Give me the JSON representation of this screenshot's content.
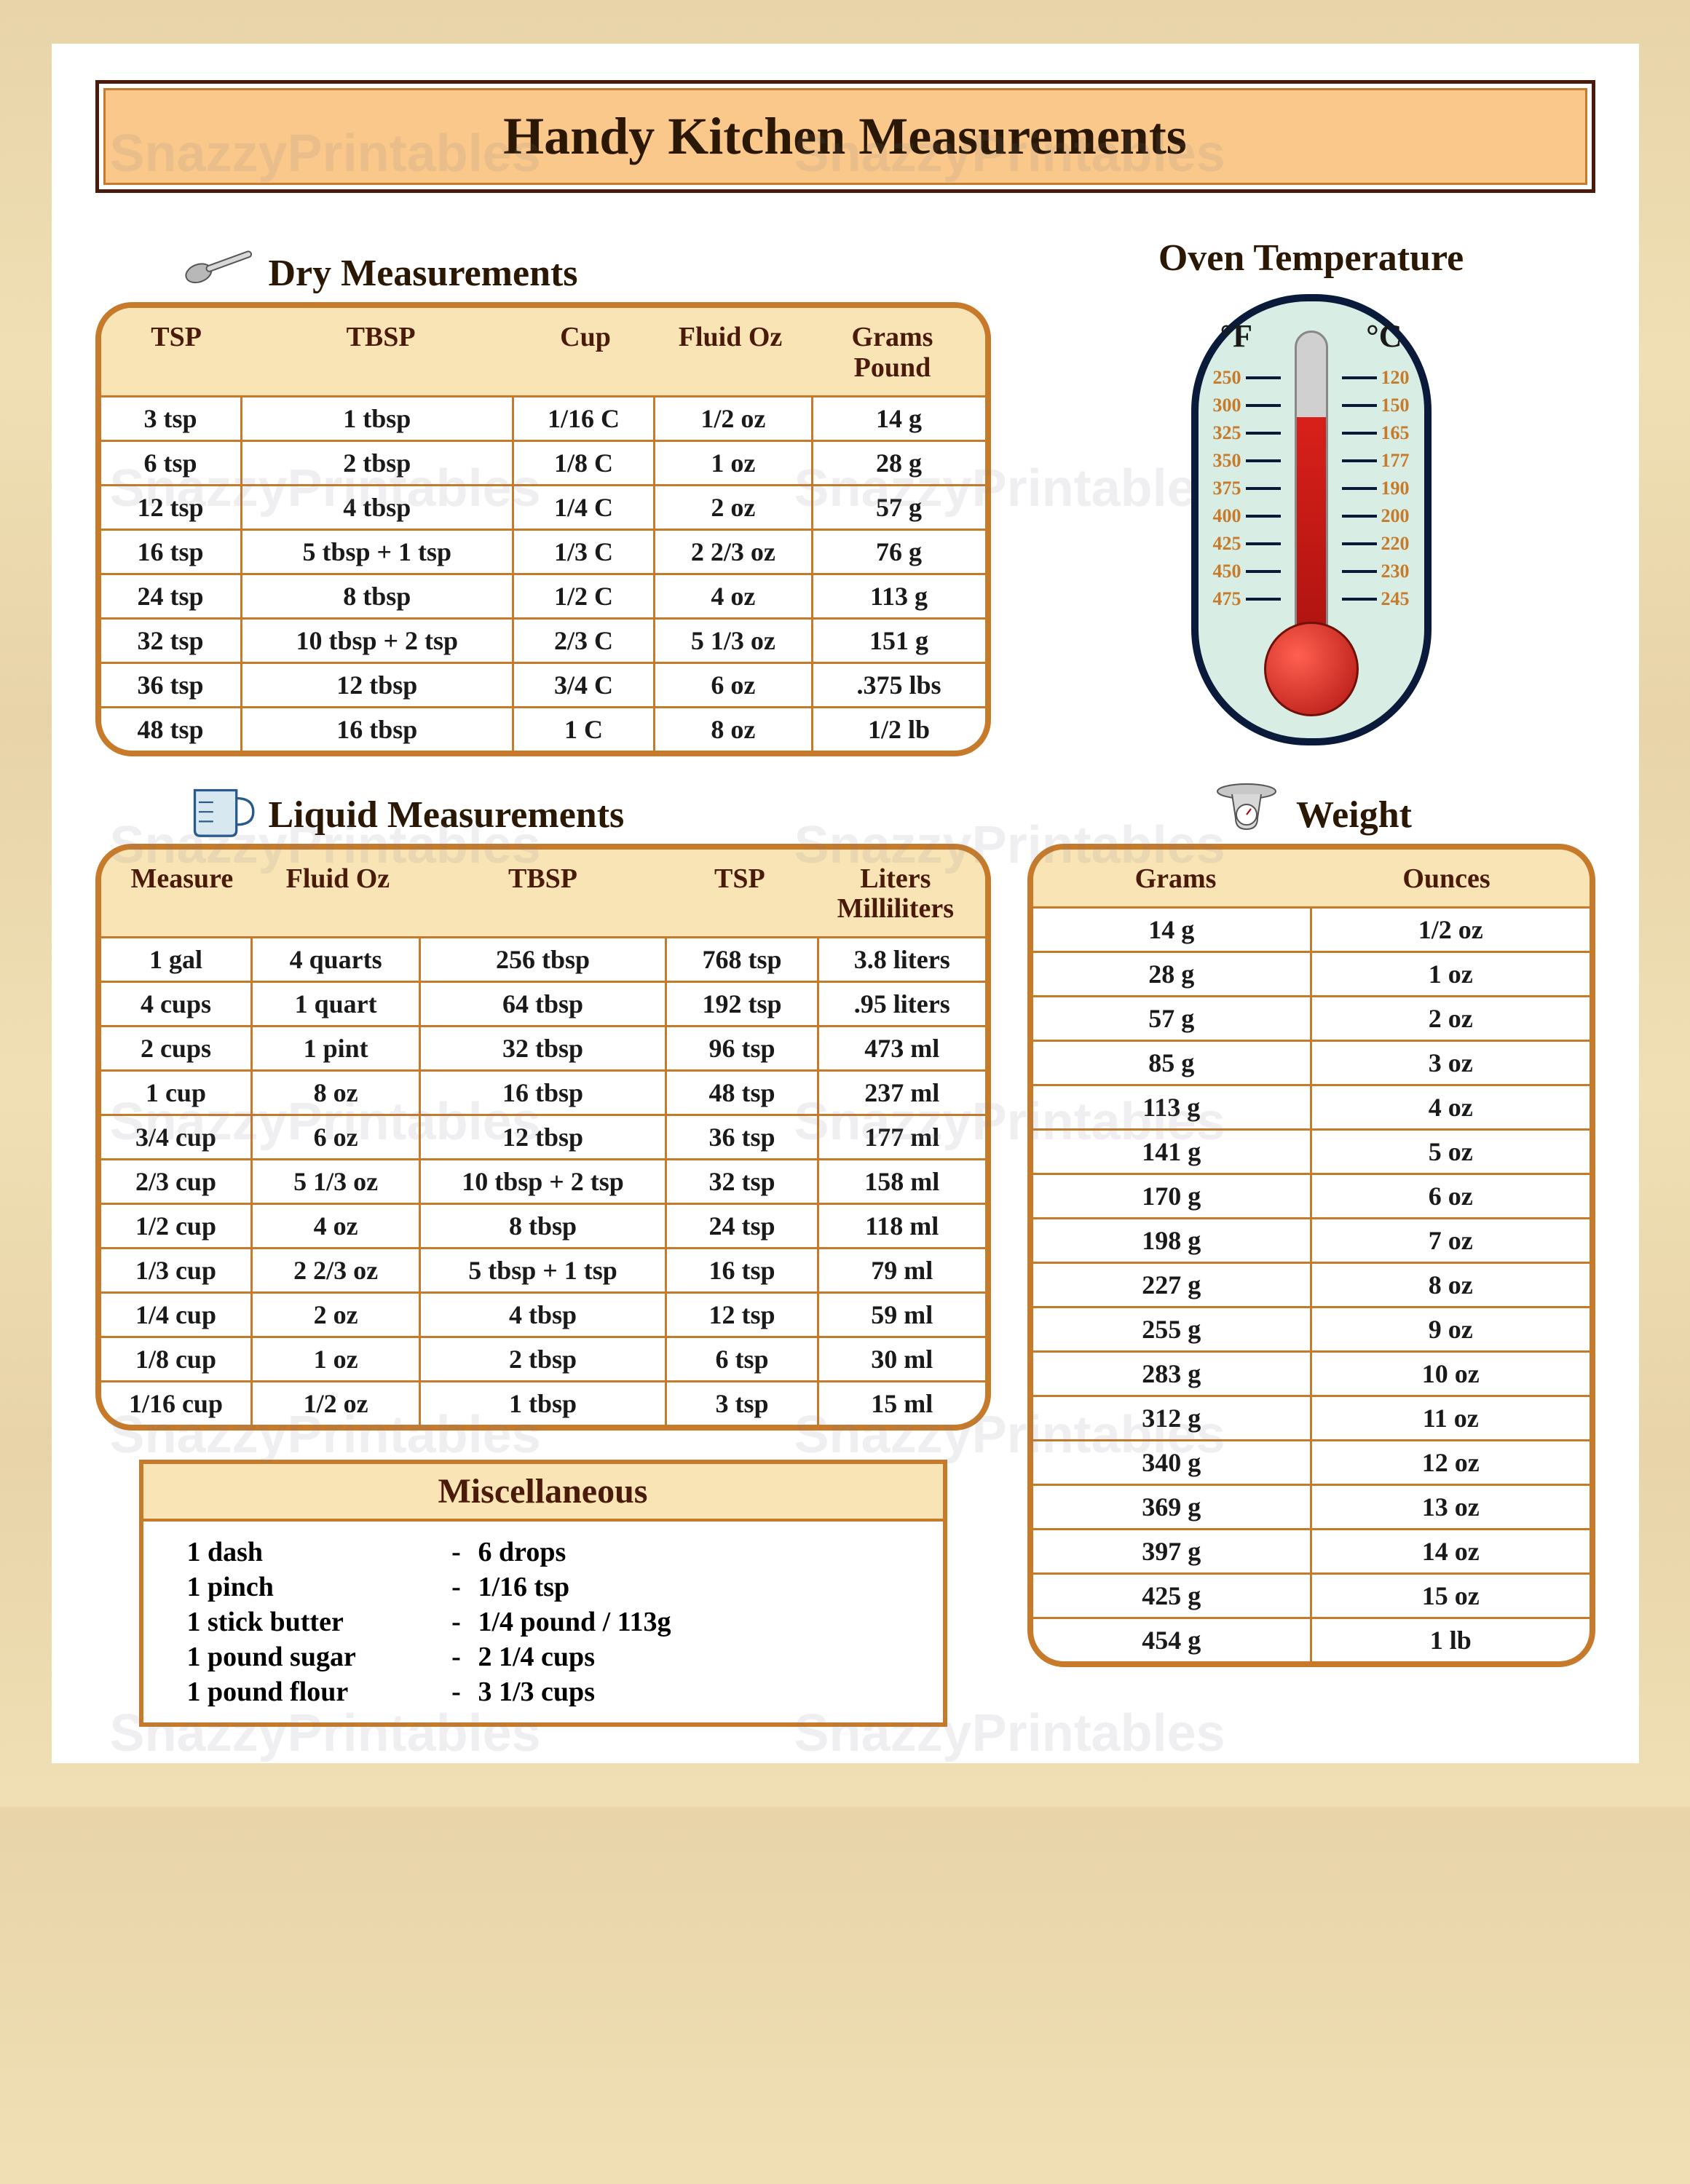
{
  "title": "Handy Kitchen Measurements",
  "watermark": "SnazzyPrintables",
  "dry": {
    "title": "Dry Measurements",
    "headers": [
      "TSP",
      "TBSP",
      "Cup",
      "Fluid Oz",
      "Grams / Pound"
    ],
    "rows": [
      [
        "3 tsp",
        "1 tbsp",
        "1/16 C",
        "1/2 oz",
        "14 g"
      ],
      [
        "6 tsp",
        "2 tbsp",
        "1/8 C",
        "1 oz",
        "28 g"
      ],
      [
        "12 tsp",
        "4 tbsp",
        "1/4 C",
        "2 oz",
        "57 g"
      ],
      [
        "16 tsp",
        "5 tbsp + 1 tsp",
        "1/3 C",
        "2 2/3 oz",
        "76 g"
      ],
      [
        "24 tsp",
        "8 tbsp",
        "1/2 C",
        "4 oz",
        "113 g"
      ],
      [
        "32 tsp",
        "10 tbsp + 2 tsp",
        "2/3 C",
        "5 1/3 oz",
        "151 g"
      ],
      [
        "36 tsp",
        "12 tbsp",
        "3/4 C",
        "6 oz",
        ".375 lbs"
      ],
      [
        "48 tsp",
        "16 tbsp",
        "1 C",
        "8 oz",
        "1/2 lb"
      ]
    ]
  },
  "liquid": {
    "title": "Liquid Measurements",
    "headers": [
      "Measure",
      "Fluid Oz",
      "TBSP",
      "TSP",
      "Liters / Milliliters"
    ],
    "rows": [
      [
        "1 gal",
        "4 quarts",
        "256 tbsp",
        "768 tsp",
        "3.8 liters"
      ],
      [
        "4 cups",
        "1 quart",
        "64 tbsp",
        "192 tsp",
        ".95 liters"
      ],
      [
        "2 cups",
        "1 pint",
        "32 tbsp",
        "96 tsp",
        "473 ml"
      ],
      [
        "1 cup",
        "8 oz",
        "16 tbsp",
        "48 tsp",
        "237 ml"
      ],
      [
        "3/4 cup",
        "6 oz",
        "12 tbsp",
        "36 tsp",
        "177 ml"
      ],
      [
        "2/3 cup",
        "5 1/3 oz",
        "10 tbsp + 2 tsp",
        "32 tsp",
        "158 ml"
      ],
      [
        "1/2 cup",
        "4 oz",
        "8 tbsp",
        "24 tsp",
        "118 ml"
      ],
      [
        "1/3 cup",
        "2 2/3 oz",
        "5 tbsp + 1 tsp",
        "16 tsp",
        "79 ml"
      ],
      [
        "1/4 cup",
        "2 oz",
        "4 tbsp",
        "12 tsp",
        "59 ml"
      ],
      [
        "1/8 cup",
        "1 oz",
        "2 tbsp",
        "6 tsp",
        "30 ml"
      ],
      [
        "1/16 cup",
        "1/2 oz",
        "1 tbsp",
        "3 tsp",
        "15 ml"
      ]
    ]
  },
  "misc": {
    "title": "Miscellaneous",
    "rows": [
      [
        "1 dash",
        "-",
        "6 drops"
      ],
      [
        "1 pinch",
        "-",
        "1/16 tsp"
      ],
      [
        "1 stick butter",
        "-",
        "1/4 pound / 113g"
      ],
      [
        "1 pound sugar",
        "-",
        "2 1/4 cups"
      ],
      [
        "1 pound flour",
        "-",
        "3 1/3 cups"
      ]
    ]
  },
  "oven": {
    "title": "Oven Temperature",
    "f_label": "°F",
    "c_label": "°C",
    "eq": "=",
    "pairs": [
      {
        "f": "250",
        "c": "120"
      },
      {
        "f": "300",
        "c": "150"
      },
      {
        "f": "325",
        "c": "165"
      },
      {
        "f": "350",
        "c": "177"
      },
      {
        "f": "375",
        "c": "190"
      },
      {
        "f": "400",
        "c": "200"
      },
      {
        "f": "425",
        "c": "220"
      },
      {
        "f": "450",
        "c": "230"
      },
      {
        "f": "475",
        "c": "245"
      }
    ]
  },
  "weight": {
    "title": "Weight",
    "headers": [
      "Grams",
      "Ounces"
    ],
    "rows": [
      [
        "14 g",
        "1/2 oz"
      ],
      [
        "28 g",
        "1 oz"
      ],
      [
        "57 g",
        "2 oz"
      ],
      [
        "85 g",
        "3 oz"
      ],
      [
        "113 g",
        "4 oz"
      ],
      [
        "141 g",
        "5 oz"
      ],
      [
        "170 g",
        "6 oz"
      ],
      [
        "198 g",
        "7 oz"
      ],
      [
        "227 g",
        "8 oz"
      ],
      [
        "255 g",
        "9 oz"
      ],
      [
        "283 g",
        "10 oz"
      ],
      [
        "312 g",
        "11 oz"
      ],
      [
        "340 g",
        "12 oz"
      ],
      [
        "369 g",
        "13 oz"
      ],
      [
        "397 g",
        "14 oz"
      ],
      [
        "425 g",
        "15 oz"
      ],
      [
        "454 g",
        "1 lb"
      ]
    ]
  }
}
